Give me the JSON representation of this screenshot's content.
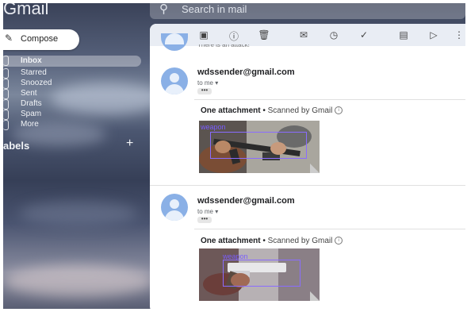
{
  "app": {
    "logo": "Gmail",
    "search_placeholder": "Search in mail"
  },
  "sidebar": {
    "compose": "Compose",
    "items": [
      {
        "label": "Inbox"
      },
      {
        "label": "Starred"
      },
      {
        "label": "Snoozed"
      },
      {
        "label": "Sent"
      },
      {
        "label": "Drafts"
      },
      {
        "label": "Spam"
      },
      {
        "label": "More"
      }
    ],
    "labels_heading": "abels",
    "labels_add": "+"
  },
  "toolbar": {
    "icons": [
      "back-arrow-icon",
      "archive-icon",
      "report-spam-icon",
      "delete-icon",
      "mark-unread-icon",
      "snooze-icon",
      "add-task-icon",
      "move-to-icon",
      "labels-icon",
      "more-icon"
    ]
  },
  "thread": {
    "partial_text": "There is an attack!",
    "messages": [
      {
        "sender": "wdssender@gmail.com",
        "to": "to me",
        "dots": "•••",
        "attachment_count": "One attachment",
        "scan": "Scanned by Gmail",
        "detection": "weapon"
      },
      {
        "sender": "wdssender@gmail.com",
        "to": "to me",
        "dots": "•••",
        "attachment_count": "One attachment",
        "scan": "Scanned by Gmail",
        "detection": "weapon"
      }
    ]
  }
}
